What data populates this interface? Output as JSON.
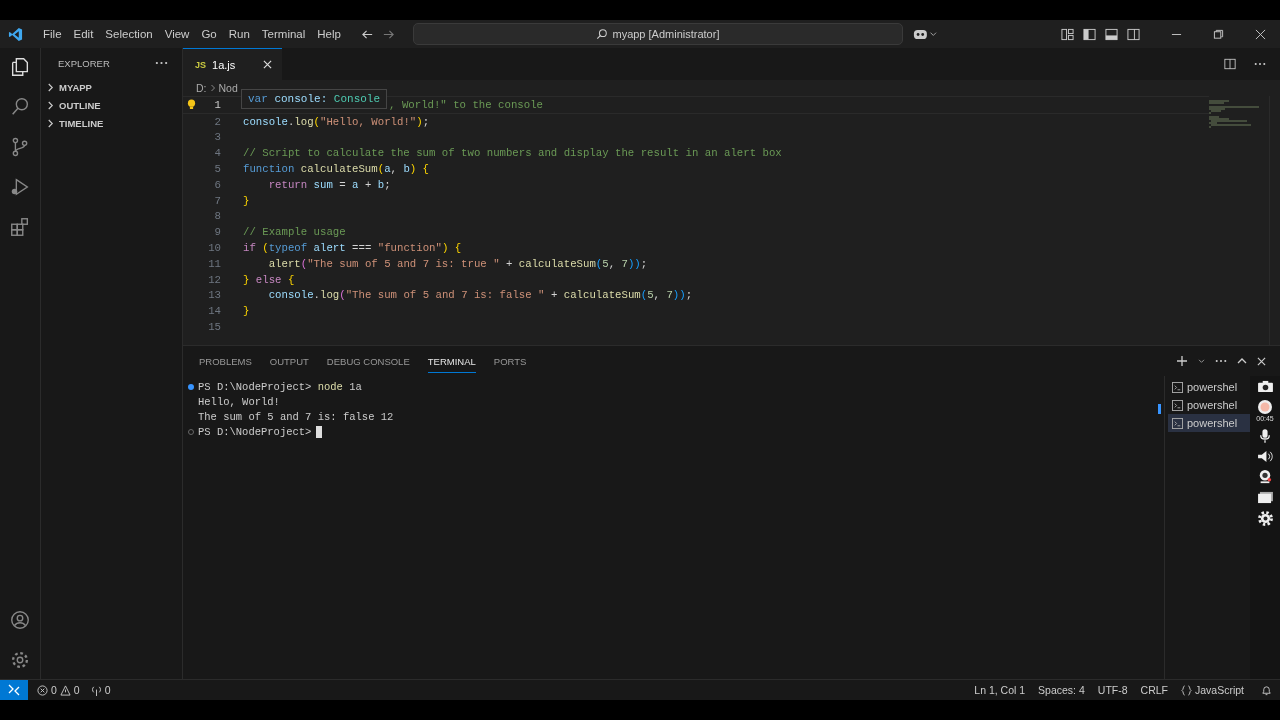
{
  "menu": [
    "File",
    "Edit",
    "Selection",
    "View",
    "Go",
    "Run",
    "Terminal",
    "Help"
  ],
  "command_center": {
    "label": "myapp [Administrator]"
  },
  "sidebar": {
    "title": "EXPLORER",
    "sections": [
      {
        "label": "MYAPP",
        "expanded": false
      },
      {
        "label": "OUTLINE",
        "expanded": false
      },
      {
        "label": "TIMELINE",
        "expanded": false
      }
    ]
  },
  "tabs": [
    {
      "badge": "JS",
      "label": "1a.js",
      "selected": true
    }
  ],
  "breadcrumb": [
    "D:",
    "Nod"
  ],
  "hover": {
    "keyword": "var",
    "name": "console:",
    "type": "Console"
  },
  "code": [
    {
      "num": "1",
      "active": true,
      "hover": true,
      "tokens": [
        {
          "kind": "cmt",
          "text": ", World!\" to the console"
        }
      ]
    },
    {
      "num": "2",
      "active": false,
      "tokens": [
        {
          "kind": "var",
          "text": "console"
        },
        {
          "kind": "plain",
          "text": "."
        },
        {
          "kind": "fn",
          "text": "log"
        },
        {
          "kind": "brace",
          "text": "("
        },
        {
          "kind": "str",
          "text": "\"Hello, World!\""
        },
        {
          "kind": "brace",
          "text": ")"
        },
        {
          "kind": "plain",
          "text": ";"
        }
      ]
    },
    {
      "num": "3",
      "active": false
    },
    {
      "num": "4",
      "active": false,
      "tokens": [
        {
          "kind": "cmt",
          "text": "// Script to calculate the sum of two numbers and display the result in an alert box"
        }
      ]
    },
    {
      "num": "5",
      "active": false,
      "tokens": [
        {
          "kind": "kw",
          "text": "function "
        },
        {
          "kind": "fn",
          "text": "calculateSum"
        },
        {
          "kind": "brace",
          "text": "("
        },
        {
          "kind": "var",
          "text": "a"
        },
        {
          "kind": "plain",
          "text": ", "
        },
        {
          "kind": "var",
          "text": "b"
        },
        {
          "kind": "brace",
          "text": ") {"
        }
      ]
    },
    {
      "num": "6",
      "active": false,
      "indent": true,
      "tokens": [
        {
          "kind": "ctl",
          "text": "return "
        },
        {
          "kind": "var",
          "text": "sum"
        },
        {
          "kind": "plain",
          "text": " = "
        },
        {
          "kind": "var",
          "text": "a"
        },
        {
          "kind": "plain",
          "text": " + "
        },
        {
          "kind": "var",
          "text": "b"
        },
        {
          "kind": "plain",
          "text": ";"
        }
      ]
    },
    {
      "num": "7",
      "active": false,
      "tokens": [
        {
          "kind": "brace",
          "text": "}"
        }
      ]
    },
    {
      "num": "8",
      "active": false
    },
    {
      "num": "9",
      "active": false,
      "tokens": [
        {
          "kind": "cmt",
          "text": "// Example usage"
        }
      ]
    },
    {
      "num": "10",
      "active": false,
      "tokens": [
        {
          "kind": "ctl",
          "text": "if "
        },
        {
          "kind": "brace",
          "text": "("
        },
        {
          "kind": "kw",
          "text": "typeof "
        },
        {
          "kind": "var",
          "text": "alert"
        },
        {
          "kind": "plain",
          "text": " === "
        },
        {
          "kind": "str",
          "text": "\"function\""
        },
        {
          "kind": "brace",
          "text": ") {"
        }
      ]
    },
    {
      "num": "11",
      "active": false,
      "indent": true,
      "tokens": [
        {
          "kind": "fn",
          "text": "alert"
        },
        {
          "kind": "paren",
          "text": "("
        },
        {
          "kind": "str",
          "text": "\"The sum of 5 and 7 is: true \""
        },
        {
          "kind": "plain",
          "text": " + "
        },
        {
          "kind": "fn",
          "text": "calculateSum"
        },
        {
          "kind": "paren2",
          "text": "("
        },
        {
          "kind": "num",
          "text": "5"
        },
        {
          "kind": "plain",
          "text": ", "
        },
        {
          "kind": "num",
          "text": "7"
        },
        {
          "kind": "paren2",
          "text": "))"
        },
        {
          "kind": "plain",
          "text": ";"
        }
      ]
    },
    {
      "num": "12",
      "active": false,
      "tokens": [
        {
          "kind": "brace",
          "text": "} "
        },
        {
          "kind": "ctl",
          "text": "else "
        },
        {
          "kind": "brace",
          "text": "{"
        }
      ]
    },
    {
      "num": "13",
      "active": false,
      "indent": true,
      "tokens": [
        {
          "kind": "var",
          "text": "console"
        },
        {
          "kind": "plain",
          "text": "."
        },
        {
          "kind": "fn",
          "text": "log"
        },
        {
          "kind": "paren",
          "text": "("
        },
        {
          "kind": "str",
          "text": "\"The sum of 5 and 7 is: false \""
        },
        {
          "kind": "plain",
          "text": " + "
        },
        {
          "kind": "fn",
          "text": "calculateSum"
        },
        {
          "kind": "paren2",
          "text": "("
        },
        {
          "kind": "num",
          "text": "5"
        },
        {
          "kind": "plain",
          "text": ", "
        },
        {
          "kind": "num",
          "text": "7"
        },
        {
          "kind": "paren2",
          "text": "))"
        },
        {
          "kind": "plain",
          "text": ";"
        }
      ]
    },
    {
      "num": "14",
      "active": false,
      "tokens": [
        {
          "kind": "brace",
          "text": "}"
        }
      ]
    },
    {
      "num": "15",
      "active": false
    }
  ],
  "panel_tabs": [
    {
      "label": "PROBLEMS",
      "selected": false
    },
    {
      "label": "OUTPUT",
      "selected": false
    },
    {
      "label": "DEBUG CONSOLE",
      "selected": false
    },
    {
      "label": "TERMINAL",
      "selected": true
    },
    {
      "label": "PORTS",
      "selected": false
    }
  ],
  "terminal": [
    {
      "kind": "prompt",
      "done": true,
      "prompt": "PS D:\\NodeProject>",
      "command": "node",
      "args": " 1a"
    },
    {
      "kind": "output",
      "text": "Hello, World!"
    },
    {
      "kind": "output",
      "text": "The sum of 5 and 7 is: false 12"
    },
    {
      "kind": "prompt",
      "done": false,
      "prompt": "PS D:\\NodeProject>"
    }
  ],
  "terminal_instances": [
    {
      "label": "powershel",
      "selected": false
    },
    {
      "label": "powershel",
      "selected": false
    },
    {
      "label": "powershel",
      "selected": true
    }
  ],
  "recorder": {
    "time": "00:45"
  },
  "status_bar": {
    "errors": "0",
    "warnings": "0",
    "ports": "0",
    "right": [
      "Ln 1, Col 1",
      "Spaces: 4",
      "UTF-8",
      "CRLF"
    ],
    "language": "JavaScript"
  }
}
